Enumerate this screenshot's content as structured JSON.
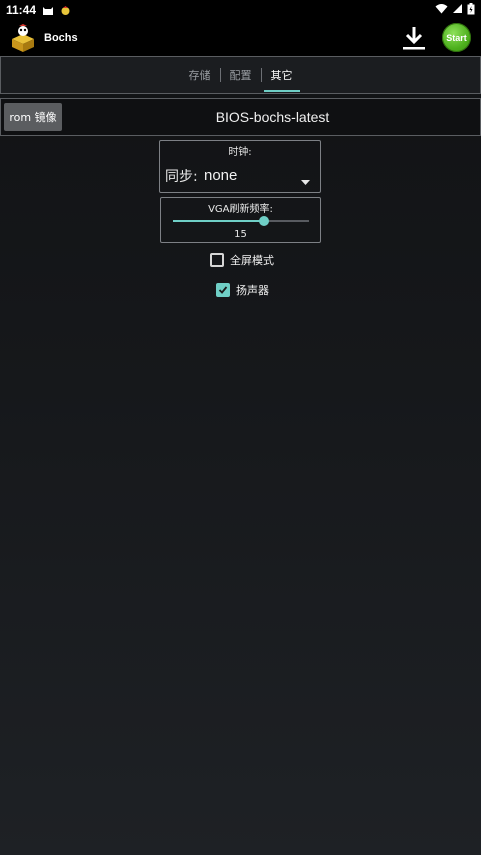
{
  "status_bar": {
    "time": "11:44",
    "icons": [
      "cat-icon",
      "app-notification-icon",
      "wifi-icon",
      "signal-icon",
      "battery-icon"
    ]
  },
  "app_bar": {
    "title": "Bochs",
    "download_icon": "download-icon",
    "start_label": "Start"
  },
  "tabs": [
    {
      "label": "存储",
      "active": false
    },
    {
      "label": "配置",
      "active": false
    },
    {
      "label": "其它",
      "active": true
    }
  ],
  "rom": {
    "button_label": "rom 镜像",
    "value": "BIOS-bochs-latest"
  },
  "clock": {
    "label": "时钟:",
    "sync_label": "同步:",
    "sync_value": "none"
  },
  "vga": {
    "label": "VGA刷新频率:",
    "value": "15",
    "slider_fraction": 0.67
  },
  "options": [
    {
      "label": "全屏模式",
      "checked": false
    },
    {
      "label": "扬声器",
      "checked": true
    }
  ],
  "colors": {
    "accent": "#6fcfc6",
    "start_green": "#4caf1c",
    "background": "#16181b"
  }
}
